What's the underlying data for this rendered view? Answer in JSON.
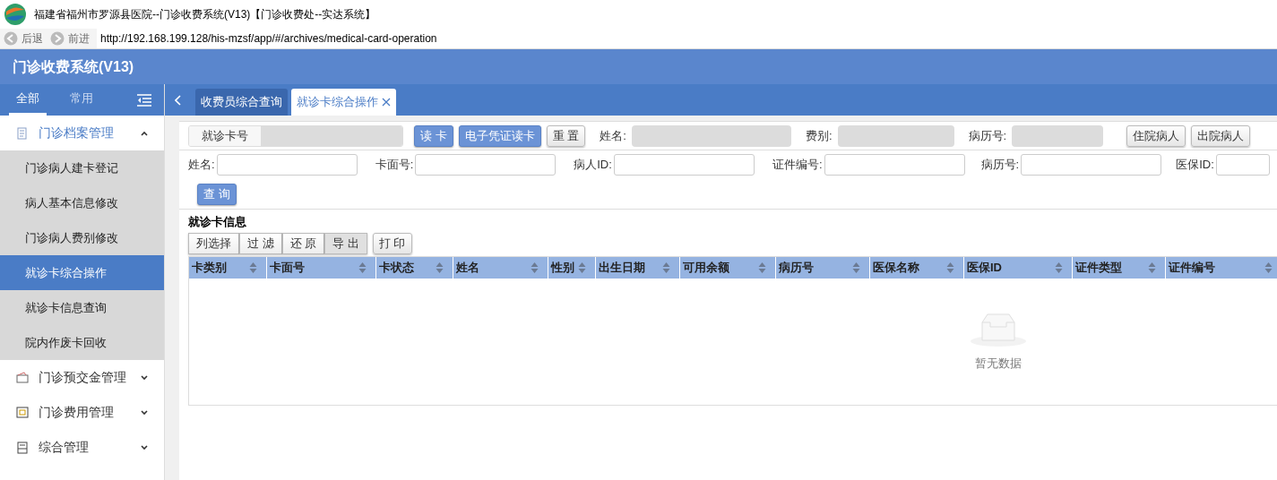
{
  "window": {
    "title": "福建省福州市罗源县医院--门诊收费系统(V13)【门诊收费处--实达系统】"
  },
  "browser": {
    "back": "后退",
    "forward": "前进",
    "url": "http://192.168.199.128/his-mzsf/app/#/archives/medical-card-operation"
  },
  "app_title": "门诊收费系统(V13)",
  "sidebar": {
    "tabs": [
      {
        "label": "全部",
        "selected": true
      },
      {
        "label": "常用",
        "selected": false
      }
    ],
    "groups": [
      {
        "label": "门诊档案管理",
        "expanded": true,
        "children": [
          {
            "label": "门诊病人建卡登记",
            "selected": false
          },
          {
            "label": "病人基本信息修改",
            "selected": false
          },
          {
            "label": "门诊病人费别修改",
            "selected": false
          },
          {
            "label": "就诊卡综合操作",
            "selected": true
          },
          {
            "label": "就诊卡信息查询",
            "selected": false
          },
          {
            "label": "院内作废卡回收",
            "selected": false
          }
        ]
      },
      {
        "label": "门诊预交金管理",
        "expanded": false
      },
      {
        "label": "门诊费用管理",
        "expanded": false
      },
      {
        "label": "综合管理",
        "expanded": false
      }
    ]
  },
  "tabs": [
    {
      "label": "收费员综合查询",
      "selected": false,
      "closable": false
    },
    {
      "label": "就诊卡综合操作",
      "selected": true,
      "closable": true
    }
  ],
  "card_bar": {
    "card_label": "就诊卡号",
    "buttons": [
      {
        "label": "读 卡",
        "kind": "primary"
      },
      {
        "label": "电子凭证读卡",
        "kind": "primary"
      },
      {
        "label": "重 置",
        "kind": "default"
      }
    ],
    "fields": [
      {
        "label": "姓名:"
      },
      {
        "label": "费别:"
      },
      {
        "label": "病历号:"
      }
    ],
    "right_buttons": [
      "住院病人",
      "出院病人"
    ]
  },
  "search": {
    "fields": [
      {
        "label": "姓名:"
      },
      {
        "label": "卡面号:"
      },
      {
        "label": "病人ID:"
      },
      {
        "label": "证件编号:"
      },
      {
        "label": "病历号:"
      },
      {
        "label": "医保ID:"
      }
    ],
    "button": "查 询"
  },
  "section_title": "就诊卡信息",
  "toolbar": [
    {
      "label": "列选择",
      "selected": false
    },
    {
      "label": "过 滤",
      "selected": false
    },
    {
      "label": "还 原",
      "selected": false
    },
    {
      "label": "导 出",
      "selected": true
    }
  ],
  "print_button": "打 印",
  "table": {
    "columns": [
      "卡类别",
      "卡面号",
      "卡状态",
      "姓名",
      "性别",
      "出生日期",
      "可用余额",
      "病历号",
      "医保名称",
      "医保ID",
      "证件类型",
      "证件编号"
    ],
    "empty_text": "暂无数据"
  }
}
